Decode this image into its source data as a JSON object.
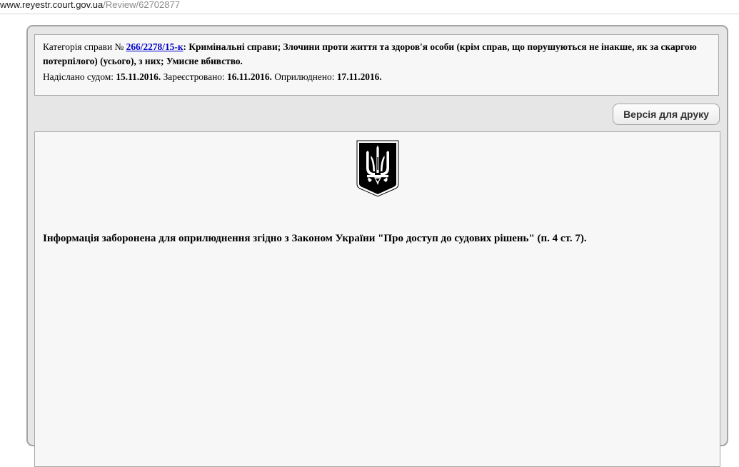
{
  "browser": {
    "url_domain": "www.reyestr.court.gov.ua",
    "url_path": "/Review/62702877"
  },
  "case_info": {
    "category_label": "Категорія справи №",
    "case_number": "266/2278/15-к",
    "category_text": ": Кримінальні справи; Злочини проти життя та здоров'я особи (крім справ, що порушуються не інакше, як за скаргою потерпілого) (усього), з них; Умисне вбивство.",
    "sent_label": "Надіслано судом:",
    "sent_date": "15.11.2016.",
    "registered_label": "Зареєстровано:",
    "registered_date": "16.11.2016.",
    "published_label": "Оприлюднено:",
    "published_date": "17.11.2016."
  },
  "toolbar": {
    "print_label": "Версія для друку"
  },
  "document": {
    "emblem_icon": "coat-of-arms-of-ukraine",
    "notice": "Інформація заборонена для оприлюднення згідно з Законом України \"Про доступ до судових рішень\" (п. 4 ст. 7)."
  },
  "colors": {
    "link": "#0000cc",
    "panel_bg": "#e6e6e6",
    "box_bg": "#f7f7f7"
  }
}
